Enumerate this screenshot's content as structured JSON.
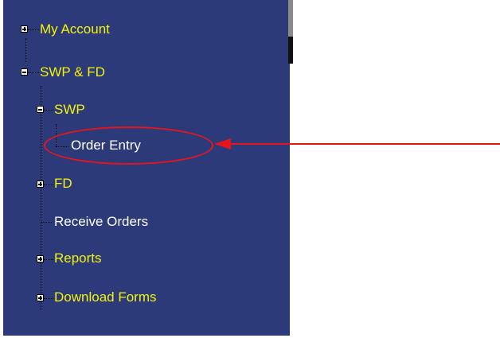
{
  "tree": {
    "my_account": "My Account",
    "swp_fd": "SWP & FD",
    "swp": "SWP",
    "order_entry": "Order Entry",
    "fd": "FD",
    "receive_orders": "Receive Orders",
    "reports": "Reports",
    "download_forms": "Download Forms"
  },
  "icons": {
    "expand": "plus-box-icon",
    "collapse": "minus-box-icon"
  },
  "colors": {
    "sidebar_bg": "#2c3a7a",
    "node_yellow": "#f3f30a",
    "node_white": "#ffffff",
    "annotation_red": "#e8141b"
  }
}
